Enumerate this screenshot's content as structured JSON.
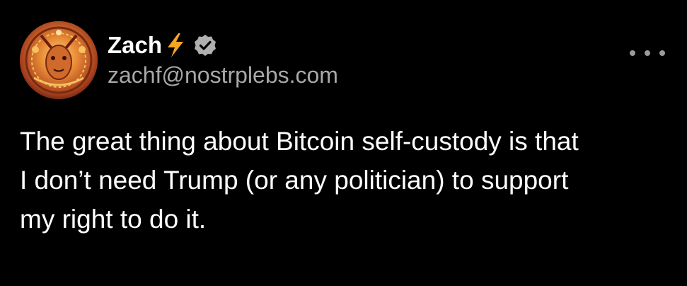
{
  "post": {
    "author": {
      "display_name": "Zach",
      "handle": "zachf@nostrplebs.com",
      "avatar_icon": "psychedelic-portrait-avatar",
      "lightning_icon": "lightning-bolt-icon",
      "verified_icon": "verified-badge-icon"
    },
    "more_icon": "more-options-icon",
    "text_lines": [
      "The great thing about Bitcoin self-custody is that",
      "I don’t need Trump (or any politician) to support",
      "my right to do it."
    ]
  },
  "colors": {
    "background": "#000000",
    "text": "#ffffff",
    "handle": "#a8a8a8",
    "lightning": "#f5a623",
    "verified_badge": "#b0b0b0"
  }
}
